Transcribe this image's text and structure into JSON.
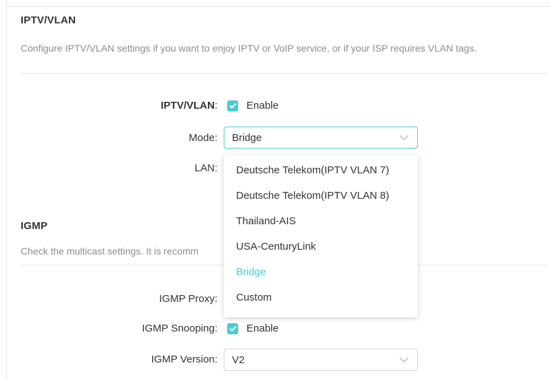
{
  "iptv_section": {
    "title": "IPTV/VLAN",
    "description": "Configure IPTV/VLAN settings if you want to enjoy IPTV or VoIP service, or if your ISP requires VLAN tags."
  },
  "iptv_vlan": {
    "label": "IPTV/VLAN",
    "colon": ":",
    "checkbox_label": "Enable",
    "checked": true
  },
  "mode": {
    "label": "Mode:",
    "value": "Bridge",
    "options": [
      "Deutsche Telekom(IPTV VLAN 7)",
      "Deutsche Telekom(IPTV VLAN 8)",
      "Thailand-AIS",
      "USA-CenturyLink",
      "Bridge",
      "Custom"
    ],
    "selected_option": "Bridge"
  },
  "lan": {
    "label": "LAN:"
  },
  "igmp_section": {
    "title": "IGMP",
    "description_visible": "Check the multicast settings. It is recomm"
  },
  "igmp_proxy": {
    "label": "IGMP Proxy:"
  },
  "igmp_snooping": {
    "label": "IGMP Snooping:",
    "checkbox_label": "Enable",
    "checked": true
  },
  "igmp_version": {
    "label": "IGMP Version:",
    "value": "V2"
  },
  "colors": {
    "accent": "#4acbd6",
    "text": "#333333",
    "muted": "#8c8c8c"
  }
}
